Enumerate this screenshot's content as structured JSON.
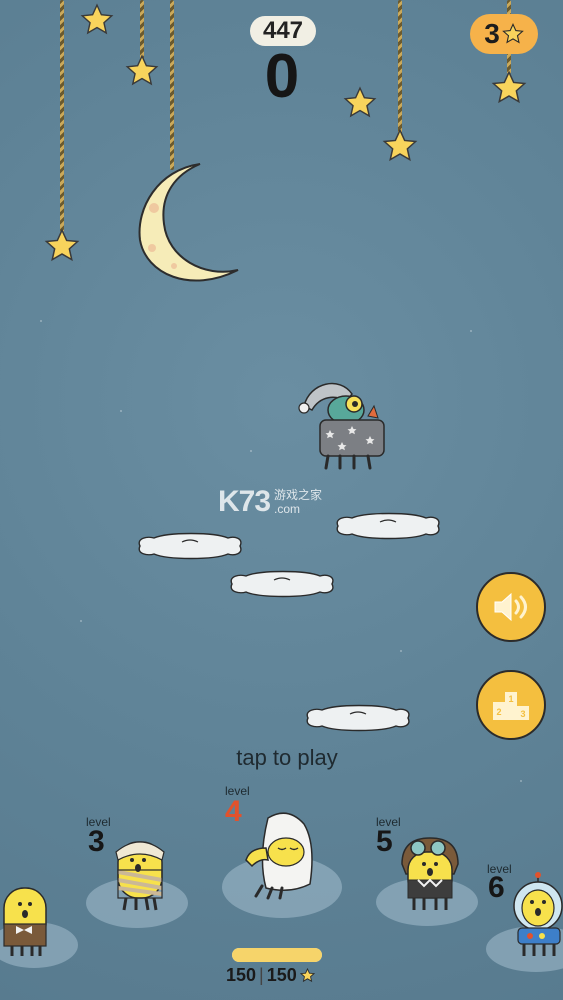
{
  "hud": {
    "best_score": "447",
    "score": "0",
    "stars_count": "3"
  },
  "prompt": {
    "tap_to_play": "tap to play"
  },
  "buttons": {
    "sound_icon": "speaker-icon",
    "leaderboard_icon": "podium-icon"
  },
  "levels": [
    {
      "label": "",
      "number": "",
      "costume": "bow-tie"
    },
    {
      "label": "level",
      "number": "3",
      "costume": "mummy"
    },
    {
      "label": "level",
      "number": "4",
      "costume": "sleepy-nightcap",
      "current": true
    },
    {
      "label": "level",
      "number": "5",
      "costume": "aviator"
    },
    {
      "label": "level",
      "number": "6",
      "costume": "astronaut"
    }
  ],
  "progress": {
    "current": "150",
    "separator": "|",
    "total": "150",
    "fraction": 1.0
  },
  "watermark": {
    "main": "K73",
    "line1": "游戏之家",
    "line2": ".com"
  },
  "colors": {
    "sky": "#5f8397",
    "star": "#f8d45c",
    "accent_orange": "#f6b24a",
    "current_level": "#e2522c",
    "button_yellow": "#f4bf3f"
  }
}
